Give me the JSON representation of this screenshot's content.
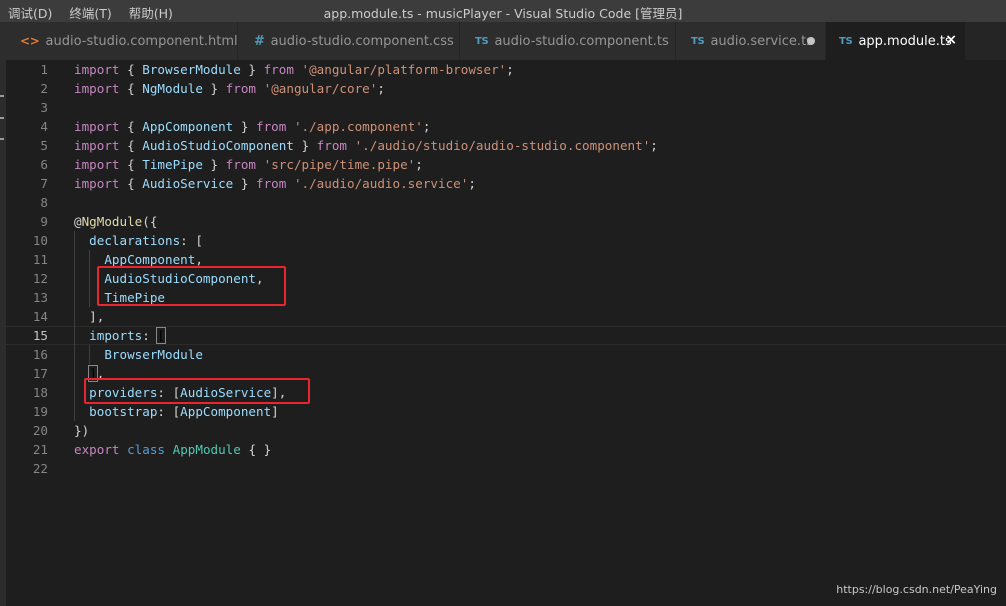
{
  "menu": [
    {
      "label": "调试(D)"
    },
    {
      "label": "终端(T)"
    },
    {
      "label": "帮助(H)"
    }
  ],
  "window_title": "app.module.ts - musicPlayer - Visual Studio Code [管理员]",
  "tabs": [
    {
      "icon": "<>",
      "label": "audio-studio.component.html",
      "active": false
    },
    {
      "icon": "#",
      "label": "audio-studio.component.css",
      "active": false
    },
    {
      "icon": "TS",
      "label": "audio-studio.component.ts",
      "active": false
    },
    {
      "icon": "TS",
      "label": "audio.service.ts",
      "active": false,
      "unsaved": true
    },
    {
      "icon": "TS",
      "label": "app.module.ts",
      "active": true,
      "close": "×"
    }
  ],
  "editor": {
    "current_line": 15,
    "lines": [
      [
        [
          "kw2",
          "import"
        ],
        [
          "p",
          " { "
        ],
        [
          "ty",
          "BrowserModule"
        ],
        [
          "p",
          " } "
        ],
        [
          "kw2",
          "from"
        ],
        [
          "p",
          " "
        ],
        [
          "str",
          "'@angular/platform-browser'"
        ],
        [
          "p",
          ";"
        ]
      ],
      [
        [
          "kw2",
          "import"
        ],
        [
          "p",
          " { "
        ],
        [
          "ty",
          "NgModule"
        ],
        [
          "p",
          " } "
        ],
        [
          "kw2",
          "from"
        ],
        [
          "p",
          " "
        ],
        [
          "str",
          "'@angular/core'"
        ],
        [
          "p",
          ";"
        ]
      ],
      [],
      [
        [
          "kw2",
          "import"
        ],
        [
          "p",
          " { "
        ],
        [
          "ty",
          "AppComponent"
        ],
        [
          "p",
          " } "
        ],
        [
          "kw2",
          "from"
        ],
        [
          "p",
          " "
        ],
        [
          "str",
          "'./app.component'"
        ],
        [
          "p",
          ";"
        ]
      ],
      [
        [
          "kw2",
          "import"
        ],
        [
          "p",
          " { "
        ],
        [
          "ty",
          "AudioStudioComponent"
        ],
        [
          "p",
          " } "
        ],
        [
          "kw2",
          "from"
        ],
        [
          "p",
          " "
        ],
        [
          "str",
          "'./audio/studio/audio-studio.component'"
        ],
        [
          "p",
          ";"
        ]
      ],
      [
        [
          "kw2",
          "import"
        ],
        [
          "p",
          " { "
        ],
        [
          "ty",
          "TimePipe"
        ],
        [
          "p",
          " } "
        ],
        [
          "kw2",
          "from"
        ],
        [
          "p",
          " "
        ],
        [
          "str",
          "'src/pipe/time.pipe'"
        ],
        [
          "p",
          ";"
        ]
      ],
      [
        [
          "kw2",
          "import"
        ],
        [
          "p",
          " { "
        ],
        [
          "ty",
          "AudioService"
        ],
        [
          "p",
          " } "
        ],
        [
          "kw2",
          "from"
        ],
        [
          "p",
          " "
        ],
        [
          "str",
          "'./audio/audio.service'"
        ],
        [
          "p",
          ";"
        ]
      ],
      [],
      [
        [
          "p",
          "@"
        ],
        [
          "dec",
          "NgModule"
        ],
        [
          "p",
          "({"
        ]
      ],
      [
        [
          "p",
          "  "
        ],
        [
          "ty",
          "declarations"
        ],
        [
          "p",
          ": ["
        ]
      ],
      [
        [
          "p",
          "    "
        ],
        [
          "ty",
          "AppComponent"
        ],
        [
          "p",
          ","
        ]
      ],
      [
        [
          "p",
          "    "
        ],
        [
          "ty",
          "AudioStudioComponent"
        ],
        [
          "p",
          ","
        ]
      ],
      [
        [
          "p",
          "    "
        ],
        [
          "ty",
          "TimePipe"
        ]
      ],
      [
        [
          "p",
          "  ],"
        ]
      ],
      [
        [
          "p",
          "  "
        ],
        [
          "ty",
          "imports"
        ],
        [
          "p",
          ": "
        ],
        [
          "bm",
          "["
        ]
      ],
      [
        [
          "p",
          "    "
        ],
        [
          "ty",
          "BrowserModule"
        ]
      ],
      [
        [
          "p",
          "  "
        ],
        [
          "bm",
          "]"
        ],
        [
          "p",
          ","
        ]
      ],
      [
        [
          "p",
          "  "
        ],
        [
          "ty",
          "providers"
        ],
        [
          "p",
          ": ["
        ],
        [
          "ty",
          "AudioService"
        ],
        [
          "p",
          "],"
        ]
      ],
      [
        [
          "p",
          "  "
        ],
        [
          "ty",
          "bootstrap"
        ],
        [
          "p",
          ": ["
        ],
        [
          "ty",
          "AppComponent"
        ],
        [
          "p",
          "]"
        ]
      ],
      [
        [
          "p",
          "})"
        ]
      ],
      [
        [
          "kw2",
          "export"
        ],
        [
          "p",
          " "
        ],
        [
          "kw",
          "class"
        ],
        [
          "p",
          " "
        ],
        [
          "cls",
          "AppModule"
        ],
        [
          "p",
          " { }"
        ]
      ],
      []
    ]
  },
  "watermark": "https://blog.csdn.net/PeaYing"
}
